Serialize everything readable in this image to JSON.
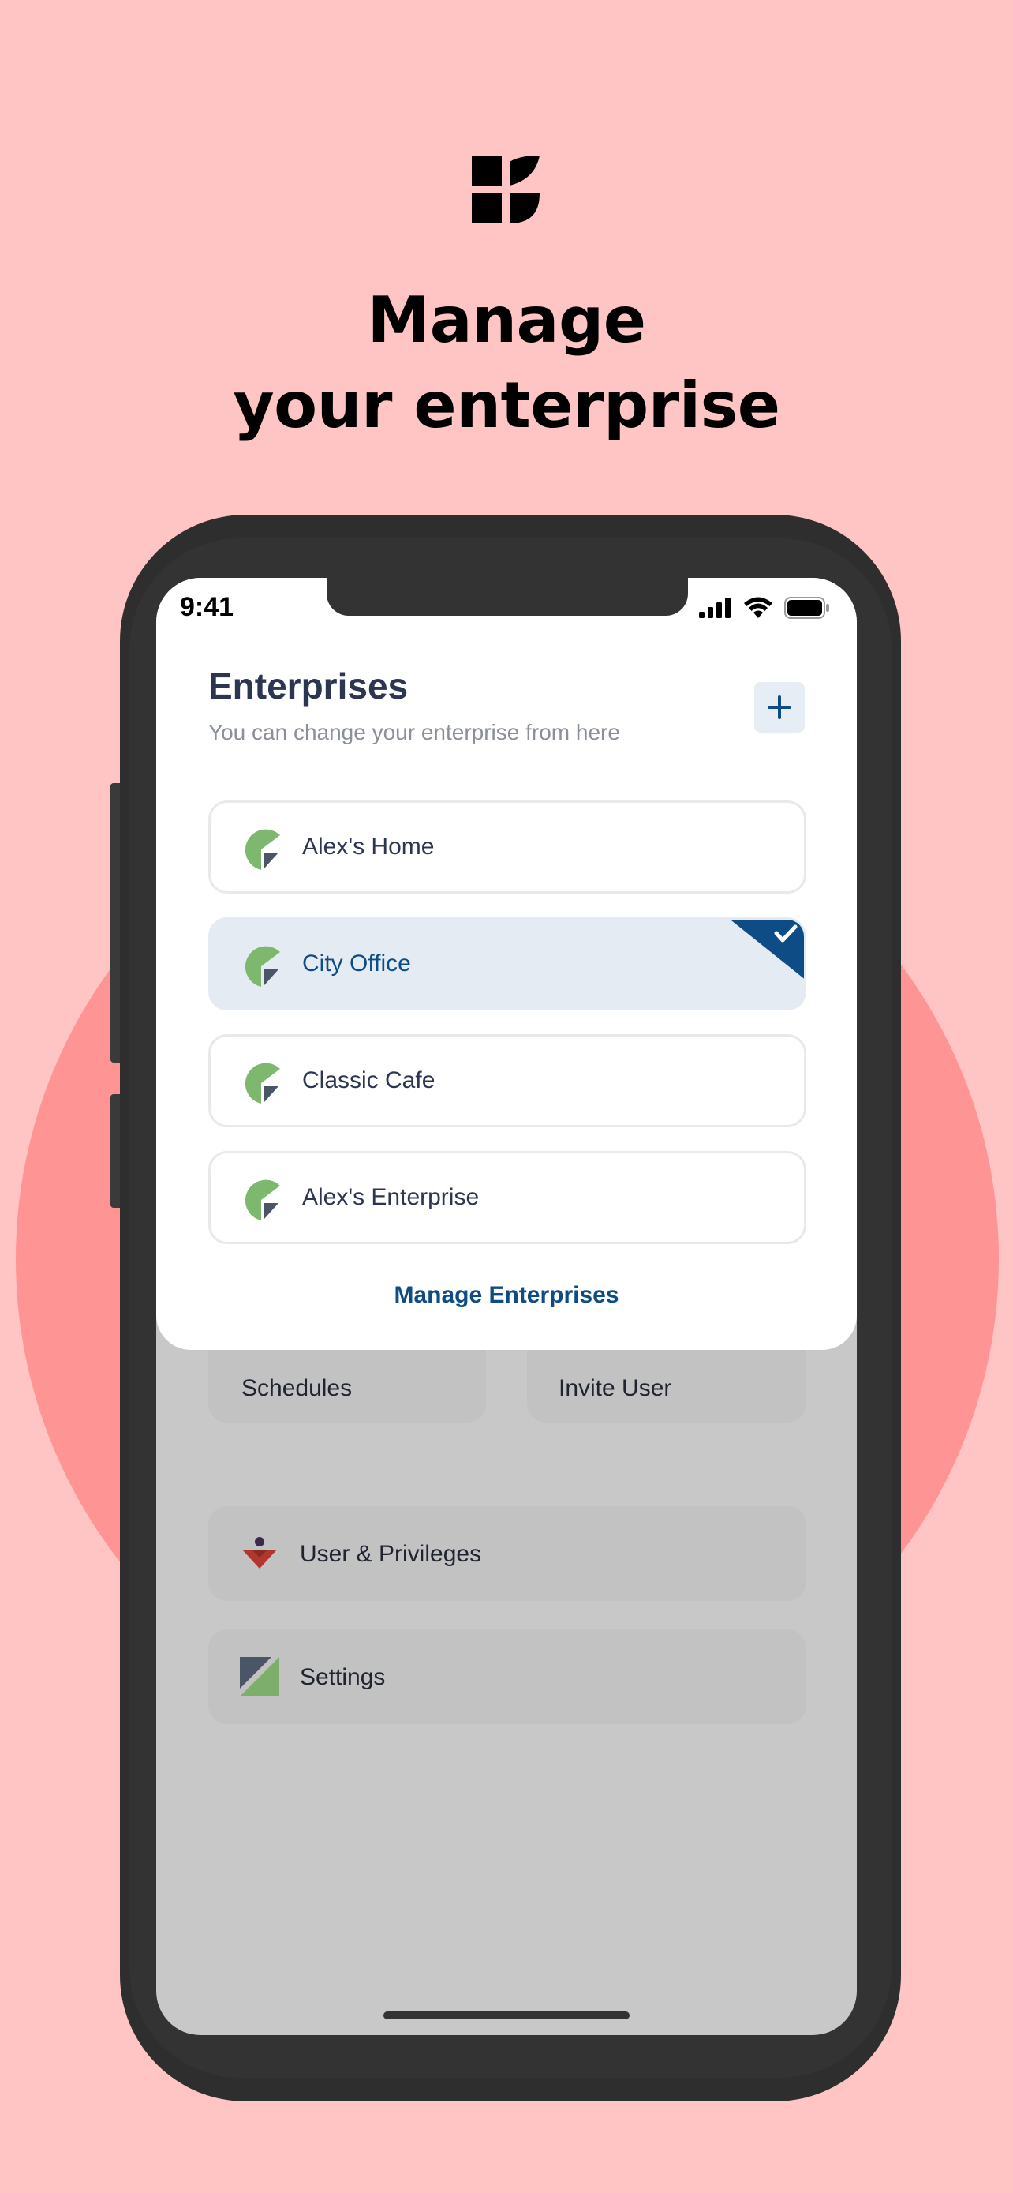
{
  "headline": {
    "line1": "Manage",
    "line2": "your enterprise"
  },
  "status_bar": {
    "time": "9:41",
    "icons": [
      "signal-icon",
      "wifi-icon",
      "battery-icon"
    ]
  },
  "sheet": {
    "title": "Enterprises",
    "subtitle": "You can change your enterprise from here",
    "add_icon": "plus-icon",
    "enterprises": [
      {
        "name": "Alex's Home",
        "selected": false
      },
      {
        "name": "City Office",
        "selected": true
      },
      {
        "name": "Classic Cafe",
        "selected": false
      },
      {
        "name": "Alex's Enterprise",
        "selected": false
      }
    ],
    "manage_link": "Manage Enterprises"
  },
  "menu": {
    "schedules": "Schedules",
    "invite_user": "Invite User",
    "user_privileges": "User & Privileges",
    "settings": "Settings"
  },
  "colors": {
    "page_bg": "#FFC4C4",
    "circle": "#FF9494",
    "accent": "#0E4C86",
    "selected_bg": "#E5EBF2",
    "icon_green": "#7DB86E",
    "icon_dark": "#4A5568"
  }
}
